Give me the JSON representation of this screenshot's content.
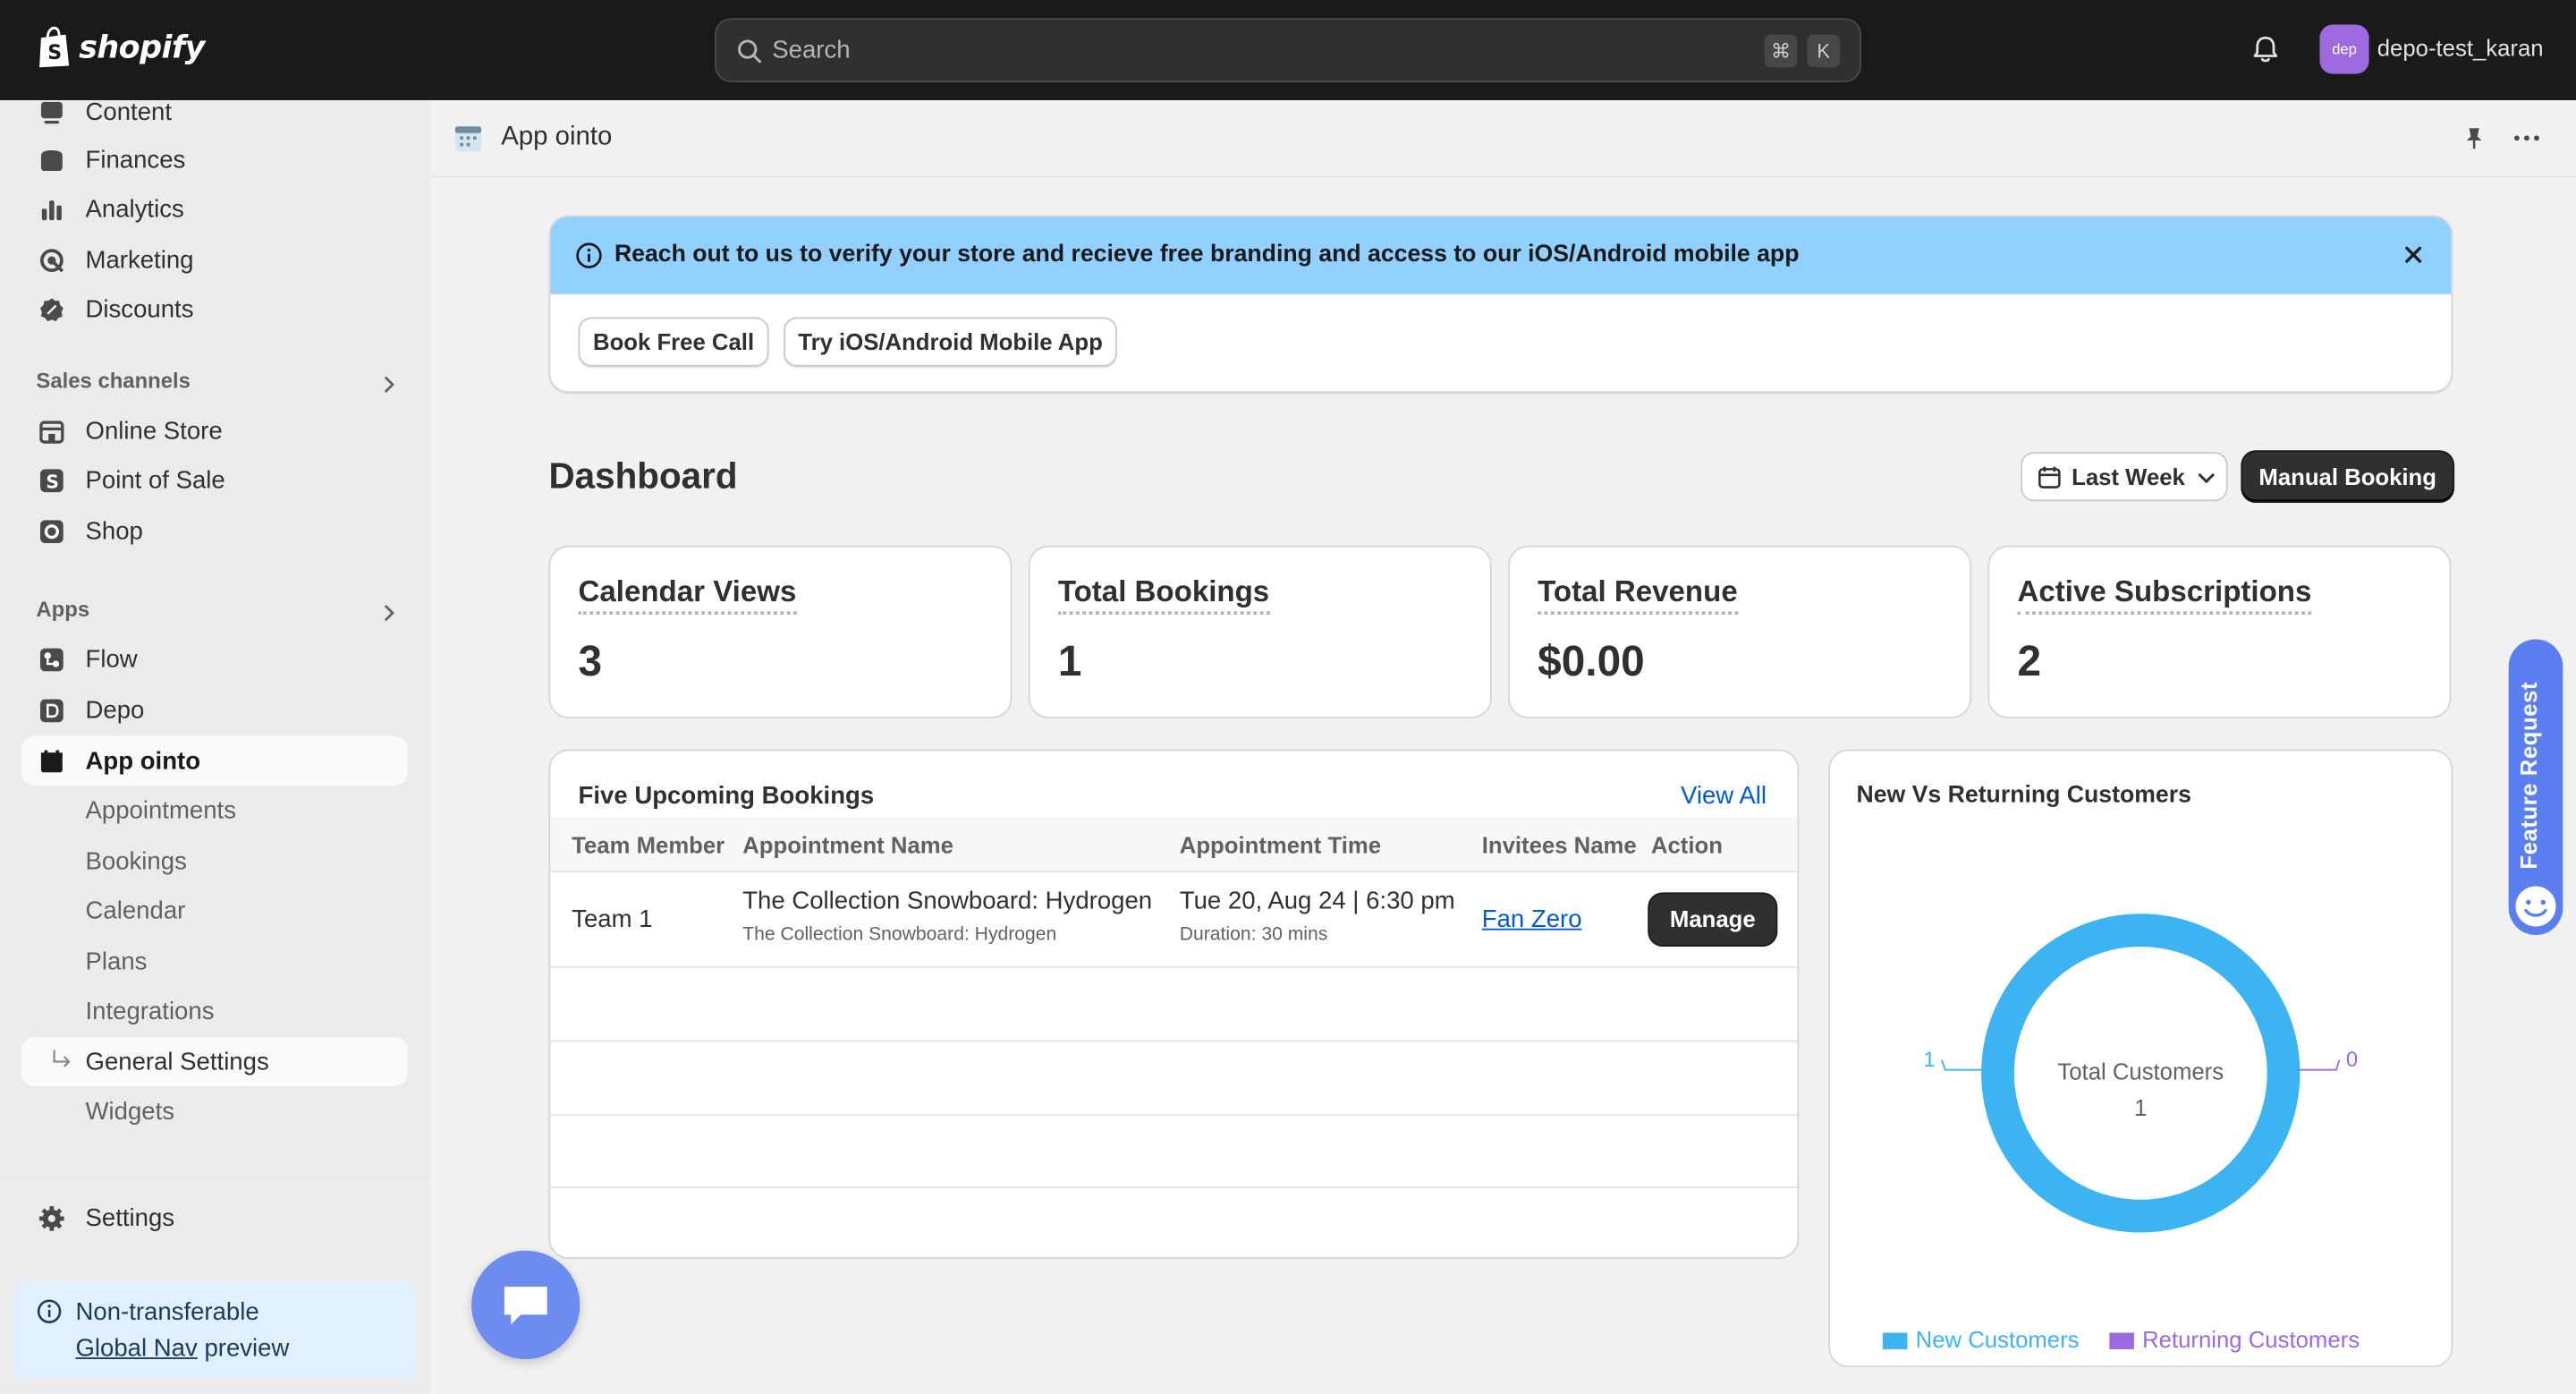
{
  "topbar": {
    "brand": "shopify",
    "search_placeholder": "Search",
    "shortcut_cmd": "⌘",
    "shortcut_key": "K",
    "avatar_initials": "dep",
    "store_name": "depo-test_karan"
  },
  "sidebar": {
    "items_top": [
      {
        "label": "Content",
        "icon": "content-icon"
      },
      {
        "label": "Finances",
        "icon": "finances-icon"
      },
      {
        "label": "Analytics",
        "icon": "analytics-icon"
      },
      {
        "label": "Marketing",
        "icon": "marketing-icon"
      },
      {
        "label": "Discounts",
        "icon": "discounts-icon"
      }
    ],
    "sales_channels_heading": "Sales channels",
    "sales_channels": [
      {
        "label": "Online Store",
        "icon": "online-store-icon"
      },
      {
        "label": "Point of Sale",
        "icon": "pos-icon"
      },
      {
        "label": "Shop",
        "icon": "shop-icon"
      }
    ],
    "apps_heading": "Apps",
    "apps": [
      {
        "label": "Flow",
        "icon": "flow-icon"
      },
      {
        "label": "Depo",
        "icon": "depo-icon"
      },
      {
        "label": "App ointo",
        "icon": "app-ointo-icon"
      }
    ],
    "app_subitems": [
      "Appointments",
      "Bookings",
      "Calendar",
      "Plans",
      "Integrations",
      "General Settings",
      "Widgets"
    ],
    "settings_label": "Settings",
    "notice": {
      "line1": "Non-transferable",
      "link": "Global Nav",
      "line2_rest": "preview"
    }
  },
  "page_header": {
    "title": "App ointo"
  },
  "banner": {
    "message": "Reach out to us to verify your store and recieve free branding and access to our iOS/Android mobile app",
    "button_1": "Book Free Call",
    "button_2": "Try iOS/Android Mobile App"
  },
  "dashboard": {
    "title": "Dashboard",
    "date_range": "Last Week",
    "manual_booking": "Manual Booking",
    "stats": [
      {
        "label": "Calendar Views",
        "value": "3"
      },
      {
        "label": "Total Bookings",
        "value": "1"
      },
      {
        "label": "Total Revenue",
        "value": "$0.00"
      },
      {
        "label": "Active Subscriptions",
        "value": "2"
      }
    ]
  },
  "bookings": {
    "title": "Five Upcoming Bookings",
    "view_all": "View All",
    "columns": [
      "Team Member",
      "Appointment Name",
      "Appointment Time",
      "Invitees Name",
      "Action"
    ],
    "rows": [
      {
        "team_member": "Team 1",
        "appointment_name": "The Collection Snowboard: Hydrogen",
        "appointment_sub": "The Collection Snowboard: Hydrogen",
        "time": "Tue 20, Aug 24 | 6:30 pm",
        "duration": "Duration: 30 mins",
        "invitee": "Fan Zero",
        "action": "Manage"
      }
    ]
  },
  "chart_data": {
    "type": "pie",
    "title": "New Vs Returning Customers",
    "categories": [
      "New Customers",
      "Returning Customers"
    ],
    "values": [
      1,
      0
    ],
    "center_label": "Total Customers",
    "center_value": "1",
    "colors": [
      "#3db4f2",
      "#9c6ade"
    ],
    "value_labels": [
      "1",
      "0"
    ],
    "legend_position": "bottom"
  },
  "floating": {
    "feature_request": "Feature Request"
  },
  "colors": {
    "topbar": "#1a1a1a",
    "banner": "#91d0ff",
    "link": "#005bd3",
    "chat_fab": "#6c8cf0"
  }
}
